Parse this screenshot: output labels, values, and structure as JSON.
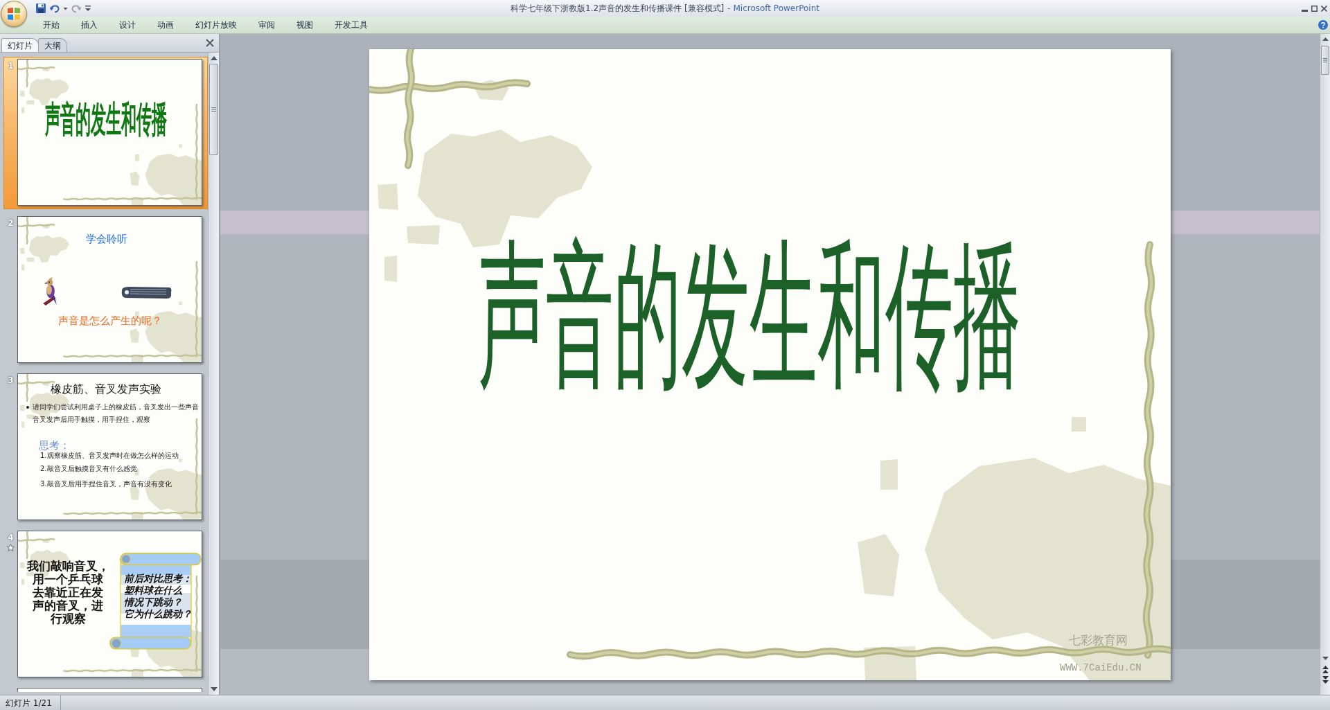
{
  "window": {
    "title": "科学七年级下浙教版1.2声音的发生和传播课件 [兼容模式]",
    "app_name": "- Microsoft PowerPoint"
  },
  "ribbon_tabs": [
    {
      "label": "开始",
      "selected": false
    },
    {
      "label": "插入",
      "selected": false
    },
    {
      "label": "设计",
      "selected": false
    },
    {
      "label": "动画",
      "selected": false
    },
    {
      "label": "幻灯片放映",
      "selected": false
    },
    {
      "label": "审阅",
      "selected": false
    },
    {
      "label": "视图",
      "selected": false
    },
    {
      "label": "开发工具",
      "selected": false
    }
  ],
  "slides_pane": {
    "tabs": [
      {
        "label": "幻灯片",
        "selected": true
      },
      {
        "label": "大纲",
        "selected": false
      }
    ],
    "thumbnails": [
      {
        "kind": "title",
        "number": "1",
        "selected": true,
        "animated": false,
        "title": "声音的发生和传播"
      },
      {
        "kind": "question",
        "number": "2",
        "selected": false,
        "animated": false,
        "heading": "学会聆听",
        "question": "声音是怎么产生的呢？"
      },
      {
        "kind": "experiment",
        "number": "3",
        "selected": false,
        "animated": false,
        "title": "橡皮筋、音叉发声实验",
        "bullet_lines": [
          "请同学们尝试利用桌子上的橡皮筋，音叉发出一些声音",
          "音叉发声后用手触摸，用手捏住，观察"
        ],
        "think_label": "思考：",
        "questions": [
          "1.观察橡皮筋、音叉发声时在做怎么样的运动",
          "2.敲音叉后触摸音叉有什么感觉",
          "3.敲音叉后用手捏住音叉，声音有没有变化"
        ]
      },
      {
        "kind": "scroll",
        "number": "4",
        "selected": false,
        "animated": true,
        "body_lines": [
          "我们敲响音叉，",
          "用一个乒乓球",
          "去靠近正在发",
          "声的音叉，进",
          "行观察"
        ],
        "scroll_lines": [
          "前后对比思考：",
          "塑料球在什么",
          "情况下跳动？",
          "它为什么跳动？"
        ]
      },
      {
        "kind": "cut_off",
        "selected": false
      }
    ]
  },
  "slide": {
    "title": "声音的发生和传播",
    "site_name": "七彩教育网",
    "site_url": "WWW.7CaiEdu.CN"
  },
  "status_bar": {
    "slide_position": "幻灯片 1/21"
  }
}
